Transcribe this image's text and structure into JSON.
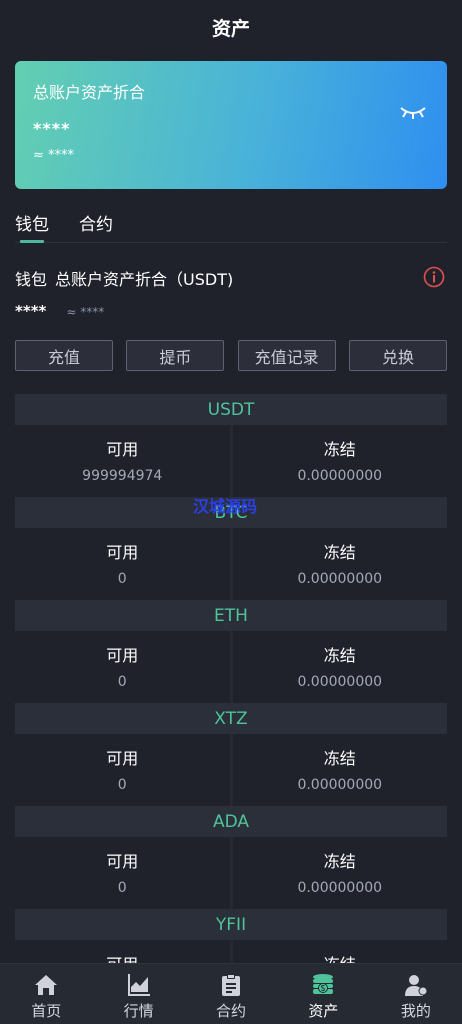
{
  "header": {
    "title": "资产"
  },
  "card": {
    "label": "总账户资产折合",
    "value": "****",
    "approx": "≈ ****"
  },
  "tabs": [
    "钱包",
    "合约"
  ],
  "summary": {
    "prefix": "钱包",
    "label": "总账户资产折合（USDT)",
    "value": "****",
    "approx": "≈ ****"
  },
  "actions": [
    "充值",
    "提币",
    "充值记录",
    "兑换"
  ],
  "assets": [
    {
      "name": "USDT",
      "available_label": "可用",
      "available": "999994974",
      "frozen_label": "冻结",
      "frozen": "0.00000000"
    },
    {
      "name": "BTC",
      "available_label": "可用",
      "available": "0",
      "frozen_label": "冻结",
      "frozen": "0.00000000"
    },
    {
      "name": "ETH",
      "available_label": "可用",
      "available": "0",
      "frozen_label": "冻结",
      "frozen": "0.00000000"
    },
    {
      "name": "XTZ",
      "available_label": "可用",
      "available": "0",
      "frozen_label": "冻结",
      "frozen": "0.00000000"
    },
    {
      "name": "ADA",
      "available_label": "可用",
      "available": "0",
      "frozen_label": "冻结",
      "frozen": "0.00000000"
    },
    {
      "name": "YFII",
      "available_label": "可用",
      "available": "",
      "frozen_label": "冻结",
      "frozen": ""
    }
  ],
  "watermark": "汉城源码",
  "tabbar": [
    "首页",
    "行情",
    "合约",
    "资产",
    "我的"
  ],
  "colors": {
    "accent": "#4fc49a",
    "info": "#e2504f",
    "background": "#1f222b"
  }
}
